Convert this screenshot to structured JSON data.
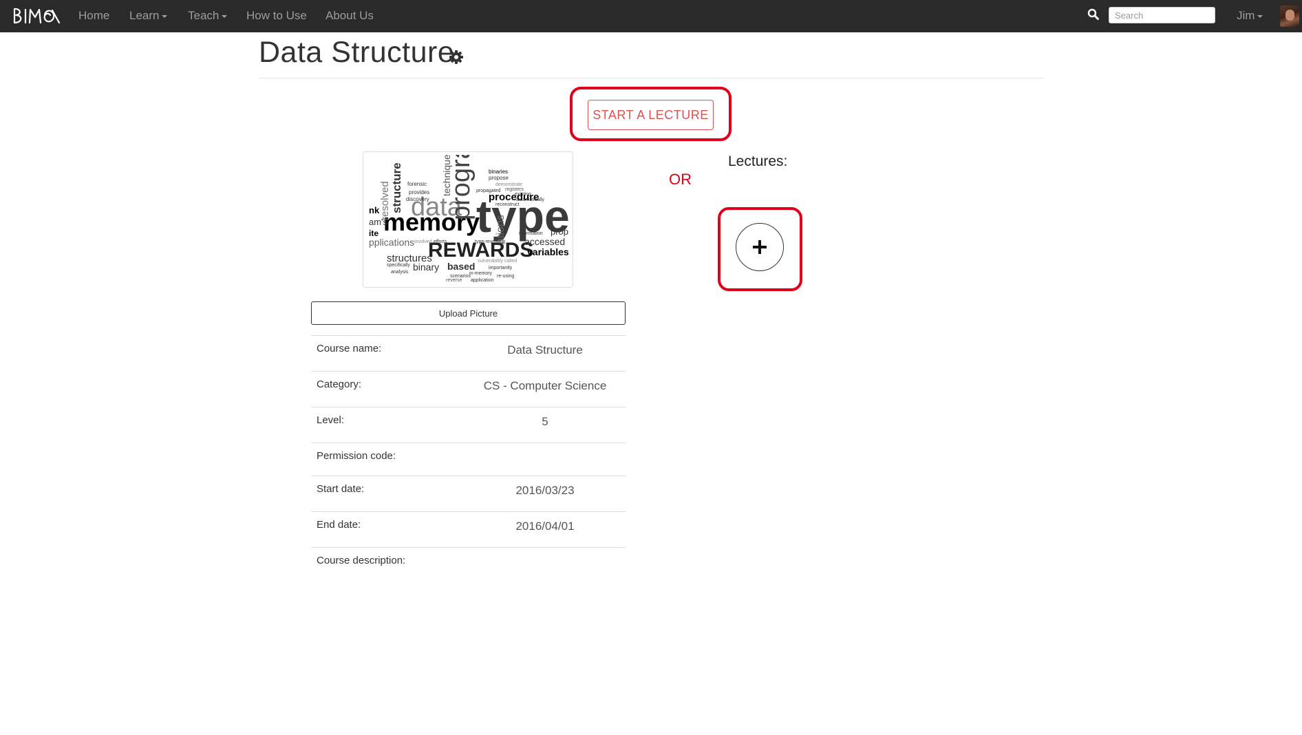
{
  "navbar": {
    "brand_icon": "bimo-logo",
    "items": [
      {
        "label": "Home",
        "dropdown": false
      },
      {
        "label": "Learn",
        "dropdown": true
      },
      {
        "label": "Teach",
        "dropdown": true
      },
      {
        "label": "How to Use",
        "dropdown": false
      },
      {
        "label": "About Us",
        "dropdown": false
      }
    ],
    "search": {
      "placeholder": "Search",
      "value": "",
      "icon": "search-icon"
    },
    "user": {
      "name": "Jim",
      "dropdown": true,
      "avatar_icon": "avatar"
    }
  },
  "page": {
    "title": "Data Structure",
    "settings_icon": "gear-icon"
  },
  "actions": {
    "start_lecture_label": "START A LECTURE",
    "or_label": "OR",
    "lectures_label": "Lectures:",
    "add_lecture_icon": "plus-icon",
    "highlight_color": "#e0001a",
    "accent_color": "#d9534f"
  },
  "course": {
    "picture": {
      "type": "word-cloud",
      "words": [
        "type",
        "memory",
        "REWARDS",
        "data",
        "program",
        "procedure",
        "structure",
        "structures",
        "accessed",
        "variables",
        "binary",
        "based",
        "technique",
        "resolved",
        "applications",
        "forensic",
        "provides",
        "discovery",
        "binaries",
        "propose",
        "demonstrate",
        "registers",
        "existing",
        "automatically",
        "reconstruct",
        "information",
        "propagated",
        "type-revealing",
        "efforts",
        "involved",
        "importantly",
        "vulnerability",
        "called",
        "specifically",
        "analysis",
        "scenarios",
        "in-memory",
        "reverse",
        "application",
        "re-using",
        "recursively"
      ]
    },
    "upload_label": "Upload Picture",
    "fields": [
      {
        "label": "Course name:",
        "value": "Data Structure"
      },
      {
        "label": "Category:",
        "value": "CS - Computer Science"
      },
      {
        "label": "Level:",
        "value": "5"
      },
      {
        "label": "Permission code:",
        "value": ""
      },
      {
        "label": "Start date:",
        "value": "2016/03/23"
      },
      {
        "label": "End date:",
        "value": "2016/04/01"
      },
      {
        "label": "Course description:",
        "value": ""
      }
    ]
  }
}
